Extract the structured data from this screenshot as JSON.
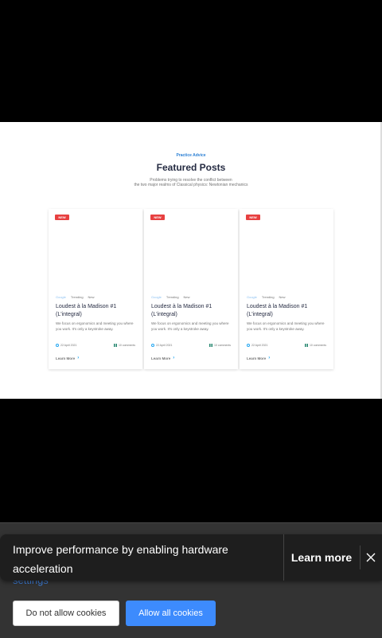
{
  "featured": {
    "eyebrow": "Practice Advice",
    "title": "Featured Posts",
    "subtitle_lines": [
      "Problems trying to resolve the conflict between",
      "the two major realms of Classical physics: Newtonian mechanics"
    ],
    "cards": [
      {
        "badge": "NEW",
        "tags": [
          "Google",
          "Trending",
          "New"
        ],
        "title": "Loudest à la Madison #1 (L'integral)",
        "text": "We focus on ergonomics and meeting you where you work. It's only a keystroke away.",
        "date": "22 April 2021",
        "comments": "10 comments",
        "learn_more": "Learn More",
        "icons": {
          "date": "clock-icon",
          "comments": "chart-icon",
          "learn_more": "chevron-right-icon"
        }
      },
      {
        "badge": "NEW",
        "tags": [
          "Google",
          "Trending",
          "New"
        ],
        "title": "Loudest à la Madison #1 (L'integral)",
        "text": "We focus on ergonomics and meeting you where you work. It's only a keystroke away.",
        "date": "22 April 2021",
        "comments": "10 comments",
        "learn_more": "Learn More",
        "icons": {
          "date": "clock-icon",
          "comments": "chart-icon",
          "learn_more": "chevron-right-icon"
        }
      },
      {
        "badge": "NEW",
        "tags": [
          "Google",
          "Trending",
          "New"
        ],
        "title": "Loudest à la Madison #1 (L'integral)",
        "text": "We focus on ergonomics and meeting you where you work. It's only a keystroke away.",
        "date": "22 April 2021",
        "comments": "10 comments",
        "learn_more": "Learn More",
        "icons": {
          "date": "clock-icon",
          "comments": "chart-icon",
          "learn_more": "chevron-right-icon"
        }
      }
    ]
  },
  "cookie_banner": {
    "settings_link": "settings",
    "deny_button": "Do not allow cookies",
    "allow_button": "Allow all cookies"
  },
  "toast": {
    "message": "Improve performance by enabling hardware acceleration",
    "action": "Learn more",
    "close_icon": "close-icon"
  },
  "colors": {
    "background": "#000000",
    "panel": "#333333",
    "toast": "#1e1e1e",
    "link": "#3f7fd9",
    "allow_button": "#3d8bfd",
    "badge": "#e74040",
    "title": "#252b42"
  }
}
